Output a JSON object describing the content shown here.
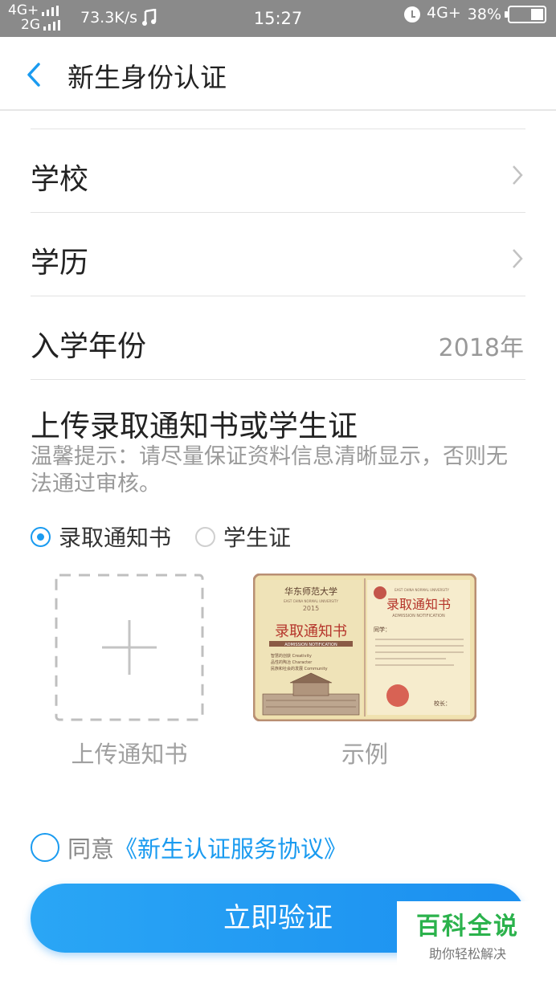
{
  "status_bar": {
    "network_top": "4G+",
    "network_bottom": "2G",
    "speed": "73.3K/s",
    "music_icon": "music-note-icon",
    "time": "15:27",
    "network_right": "4G+",
    "battery": "38%",
    "battery_level": 0.38
  },
  "header": {
    "title": "新生身份认证",
    "back_icon": "chevron-left-icon"
  },
  "rows": [
    {
      "label": "学校",
      "value": "",
      "has_arrow": true
    },
    {
      "label": "学历",
      "value": "",
      "has_arrow": true
    },
    {
      "label": "入学年份",
      "value": "2018年",
      "has_arrow": false
    }
  ],
  "upload": {
    "title": "上传录取通知书或学生证",
    "hint": "温馨提示：请尽量保证资料信息清晰显示，否则无法通过审核。",
    "options": [
      {
        "label": "录取通知书",
        "checked": true
      },
      {
        "label": "学生证",
        "checked": false
      }
    ],
    "upload_caption": "上传通知书",
    "sample_caption": "示例",
    "sample_image": {
      "school": "华东师范大学",
      "school_en": "EAST CHINA NORMAL UNIVERSITY",
      "year": "2015",
      "heading": "录取通知书",
      "heading_en": "ADMISSION NOTIFICATION",
      "mottos": [
        "智慧的创获 Creativity",
        "品性的陶冶 Character",
        "民族和社会的发展 Community"
      ],
      "greeting": "同学：",
      "sign": "校长："
    }
  },
  "agreement": {
    "prefix": "同意",
    "link": "《新生认证服务协议》"
  },
  "submit_label": "立即验证",
  "watermark": {
    "title": "百科全说",
    "subtitle": "助你轻松解决"
  },
  "colors": {
    "accent": "#1a9bf0",
    "status_bar": "#8a8a8a",
    "watermark_green": "#2bb24c"
  }
}
